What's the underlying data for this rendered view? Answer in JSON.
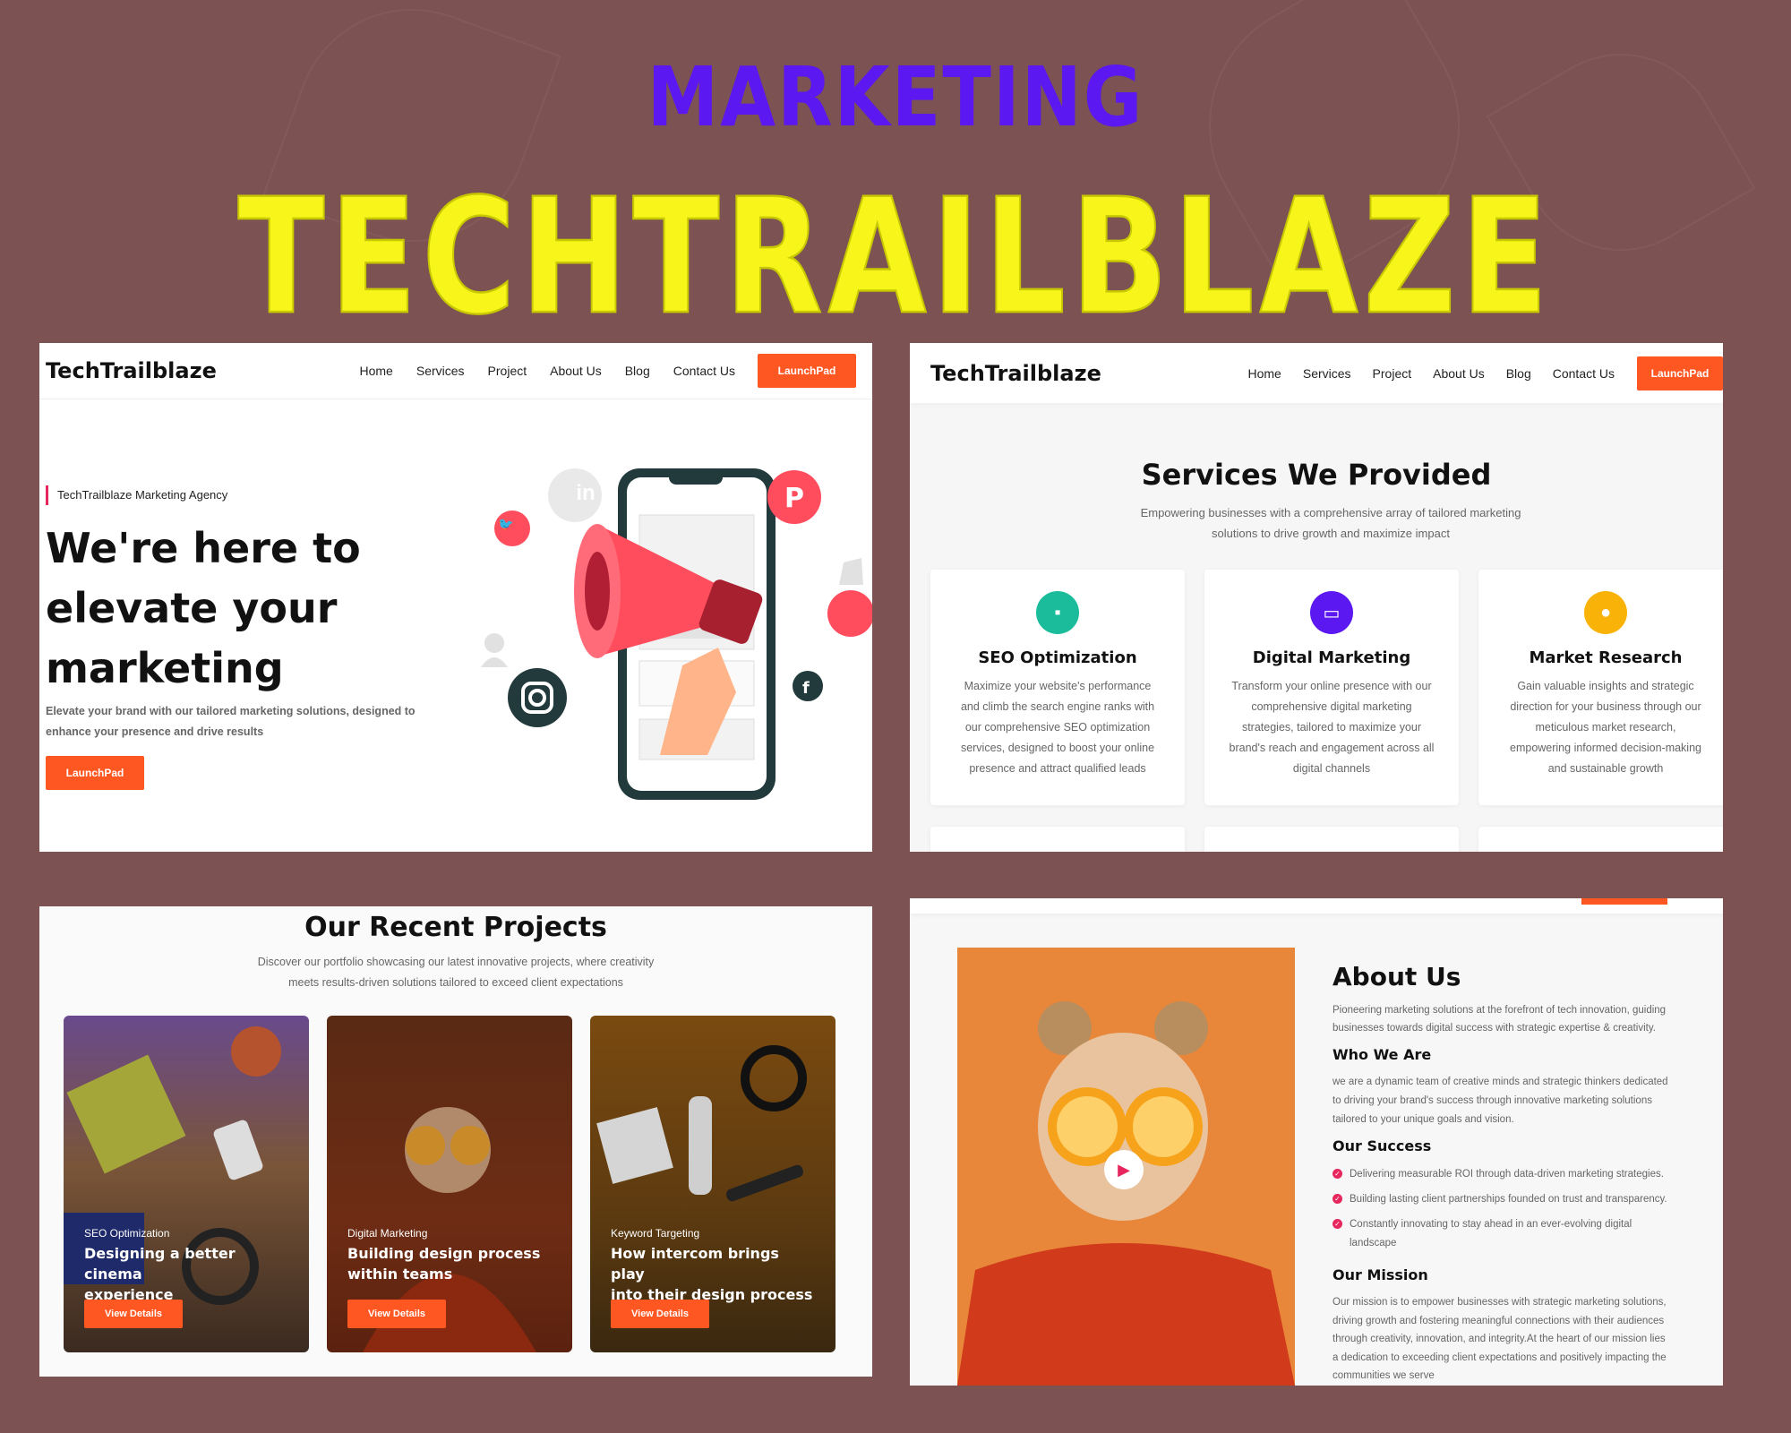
{
  "banner": {
    "category": "MARKETING",
    "brand": "TECHTRAILBLAZE"
  },
  "hero": {
    "logo": "TechTrailblaze",
    "nav": [
      "Home",
      "Services",
      "Project",
      "About Us",
      "Blog",
      "Contact Us"
    ],
    "cta": "LaunchPad",
    "tagline": "TechTrailblaze Marketing Agency",
    "headline": [
      "We're here to",
      "elevate your",
      "marketing"
    ],
    "subtext": [
      "Elevate your brand with our tailored marketing solutions, designed to",
      "enhance your presence and drive results"
    ],
    "button": "LaunchPad"
  },
  "services": {
    "logo": "TechTrailblaze",
    "nav": [
      "Home",
      "Services",
      "Project",
      "About Us",
      "Blog",
      "Contact Us"
    ],
    "cta": "LaunchPad",
    "title": "Services We Provided",
    "subtitle": [
      "Empowering businesses with a comprehensive array of tailored marketing",
      "solutions to drive growth and maximize impact"
    ],
    "cards": [
      {
        "title": "SEO Optimization",
        "icon": "chat-icon",
        "color": "#1abc9c",
        "lines": [
          "Maximize your website's performance",
          "and climb the search engine ranks with",
          "our comprehensive SEO optimization",
          "services, designed to boost your online",
          "presence and attract qualified leads"
        ]
      },
      {
        "title": "Digital Marketing",
        "icon": "monitor-icon",
        "color": "#5b18f0",
        "lines": [
          "Transform your online presence with our",
          "comprehensive digital marketing",
          "strategies, tailored to maximize your",
          "brand's reach and engagement across all",
          "digital channels"
        ]
      },
      {
        "title": "Market Research",
        "icon": "lightbulb-icon",
        "color": "#f9b208",
        "lines": [
          "Gain valuable insights and strategic",
          "direction for your business through our",
          "meticulous market research,",
          "empowering informed decision-making",
          "and sustainable growth"
        ]
      }
    ]
  },
  "projects": {
    "title": "Our Recent Projects",
    "subtitle": [
      "Discover our portfolio showcasing our latest innovative projects, where creativity",
      "meets results-driven solutions tailored to exceed client expectations"
    ],
    "items": [
      {
        "category": "SEO Optimization",
        "title": [
          "Designing a better cinema",
          "experience"
        ],
        "button": "View Details"
      },
      {
        "category": "Digital Marketing",
        "title": [
          "Building design process",
          "within teams"
        ],
        "button": "View Details"
      },
      {
        "category": "Keyword Targeting",
        "title": [
          "How intercom brings play",
          "into their design process"
        ],
        "button": "View Details"
      }
    ]
  },
  "about": {
    "title": "About Us",
    "intro": [
      "Pioneering marketing solutions at the forefront of tech innovation, guiding",
      "businesses towards digital success with strategic expertise & creativity."
    ],
    "who_title": "Who We Are",
    "who_text": [
      "we are a dynamic team of creative minds and strategic thinkers dedicated",
      "to driving your brand's success through innovative marketing solutions",
      "tailored to your unique goals and vision."
    ],
    "success_title": "Our Success",
    "success_items": [
      "Delivering measurable ROI through data-driven marketing strategies.",
      "Building lasting client partnerships founded on trust and transparency.",
      "Constantly innovating to stay ahead in an ever-evolving digital",
      "landscape"
    ],
    "mission_title": "Our Mission",
    "mission_text": [
      "Our mission is to empower businesses with strategic marketing solutions,",
      "driving growth and fostering meaningful connections with their audiences",
      "through creativity, innovation, and integrity.At the heart of our mission lies",
      "a dedication to exceeding client expectations and positively impacting the",
      "communities we serve"
    ]
  }
}
